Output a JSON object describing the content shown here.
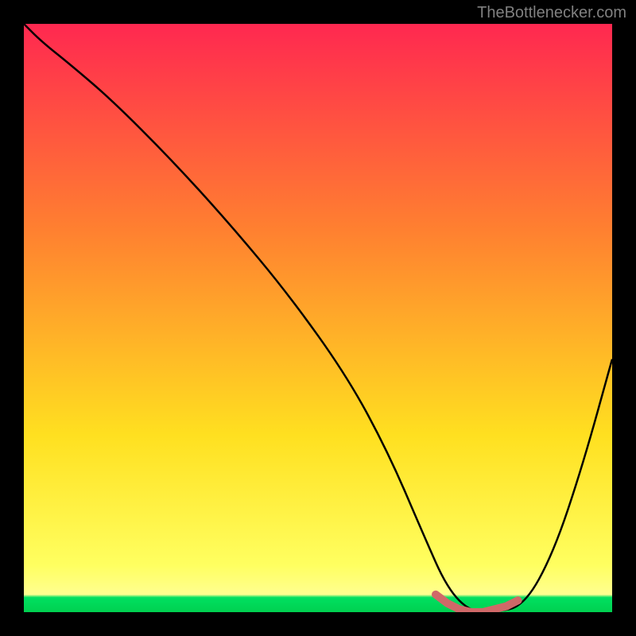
{
  "watermark": "TheBottlenecker.com",
  "chart_data": {
    "type": "line",
    "title": "",
    "xlabel": "",
    "ylabel": "",
    "xlim": [
      0,
      100
    ],
    "ylim": [
      0,
      100
    ],
    "background_gradient": {
      "top": "#ff2850",
      "mid1": "#ff8030",
      "mid2": "#ffe020",
      "bottom_band": "#ffff60",
      "green_band": "#00e060"
    },
    "series": [
      {
        "name": "curve",
        "color": "#000000",
        "x": [
          0,
          3,
          8,
          15,
          25,
          35,
          45,
          55,
          62,
          68,
          72,
          76,
          80,
          85,
          90,
          95,
          100
        ],
        "y": [
          100,
          97,
          93,
          87,
          77,
          66,
          54,
          40,
          27,
          13,
          4,
          0,
          0,
          1,
          10,
          25,
          43
        ]
      }
    ],
    "marker_segment": {
      "name": "bottleneck-zone",
      "color": "#d06868",
      "x": [
        70,
        72,
        74,
        76,
        78,
        80,
        82,
        84
      ],
      "y": [
        3,
        1.5,
        0.5,
        0,
        0,
        0.5,
        1,
        2
      ]
    }
  }
}
